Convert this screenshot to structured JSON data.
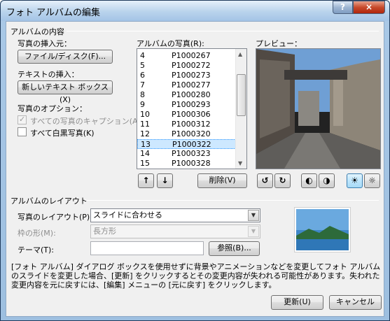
{
  "window": {
    "title": "フォト アルバムの編集",
    "help": "?",
    "close": "×"
  },
  "album_content": {
    "heading": "アルバムの内容",
    "insert_picture_label": "写真の挿入元：",
    "file_disk_button": "ファイル/ディスク(F)...",
    "insert_text_label": "テキストの挿入：",
    "new_textbox_button": "新しいテキスト ボックス(X)",
    "options_label": "写真のオプション：",
    "captions_checkbox": "すべての写真のキャプション(A)",
    "bw_checkbox": "すべて白黒写真(K)"
  },
  "album_pictures": {
    "label": "アルバムの写真(R):",
    "items": [
      {
        "num": "4",
        "file": "P1000267"
      },
      {
        "num": "5",
        "file": "P1000272"
      },
      {
        "num": "6",
        "file": "P1000273"
      },
      {
        "num": "7",
        "file": "P1000277"
      },
      {
        "num": "8",
        "file": "P1000280"
      },
      {
        "num": "9",
        "file": "P1000293"
      },
      {
        "num": "10",
        "file": "P1000306"
      },
      {
        "num": "11",
        "file": "P1000312"
      },
      {
        "num": "12",
        "file": "P1000320"
      },
      {
        "num": "13",
        "file": "P1000322"
      },
      {
        "num": "14",
        "file": "P1000323"
      },
      {
        "num": "15",
        "file": "P1000328"
      }
    ],
    "selected_index": 9,
    "move_up": "↑",
    "move_down": "↓",
    "remove_button": "削除(V)"
  },
  "preview": {
    "label": "プレビュー："
  },
  "album_layout": {
    "heading": "アルバムのレイアウト",
    "picture_layout_label": "写真のレイアウト(P):",
    "picture_layout_value": "スライドに合わせる",
    "frame_shape_label": "枠の形(M):",
    "frame_shape_value": "長方形",
    "theme_label": "テーマ(T):",
    "theme_value": "",
    "browse_button": "参照(B)..."
  },
  "description": "[フォト アルバム] ダイアログ ボックスを使用せずに背景やアニメーションなどを変更してフォト アルバムのスライドを変更した場合、[更新] をクリックするとその変更内容が失われる可能性があります。失われた変更内容を元に戻すには、[編集] メニューの [元に戻す] をクリックします。",
  "footer": {
    "update_button": "更新(U)",
    "cancel_button": "キャンセル"
  },
  "colors": {
    "selection": "#cde8ff",
    "title_gradient": "#b9d3ec"
  }
}
